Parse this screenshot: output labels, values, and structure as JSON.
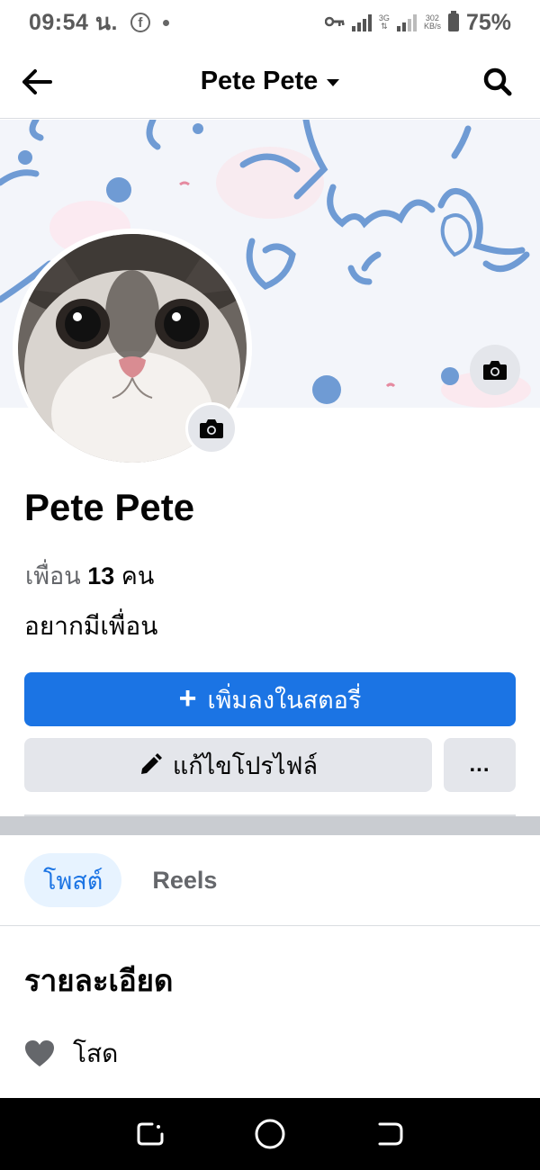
{
  "status_bar": {
    "time": "09:54 น.",
    "fb_icon": "f",
    "net_top": "3G",
    "net_speed_value": "302",
    "net_speed_unit": "KB/s",
    "battery": "75%"
  },
  "header": {
    "title": "Pete Pete",
    "back_icon": "arrow-left-icon",
    "search_icon": "search-icon"
  },
  "profile": {
    "name": "Pete Pete",
    "friends_prefix": "เพื่อน",
    "friends_count": "13",
    "friends_suffix": "คน",
    "bio": "อยากมีเพื่อน"
  },
  "actions": {
    "add_story_label": "เพิ่มลงในสตอรี่",
    "add_story_icon": "+",
    "edit_profile_label": "แก้ไขโปรไฟล์",
    "more_label": "..."
  },
  "tabs": [
    {
      "label": "โพสต์",
      "active": true
    },
    {
      "label": "Reels",
      "active": false
    }
  ],
  "details": {
    "title": "รายละเอียด",
    "items": [
      {
        "icon": "heart-icon",
        "label": "โสด"
      }
    ]
  },
  "colors": {
    "accent": "#1b74e4",
    "button_gray": "#e4e6eb",
    "tab_active_bg": "#e7f3ff",
    "secondary_text": "#65676b"
  }
}
